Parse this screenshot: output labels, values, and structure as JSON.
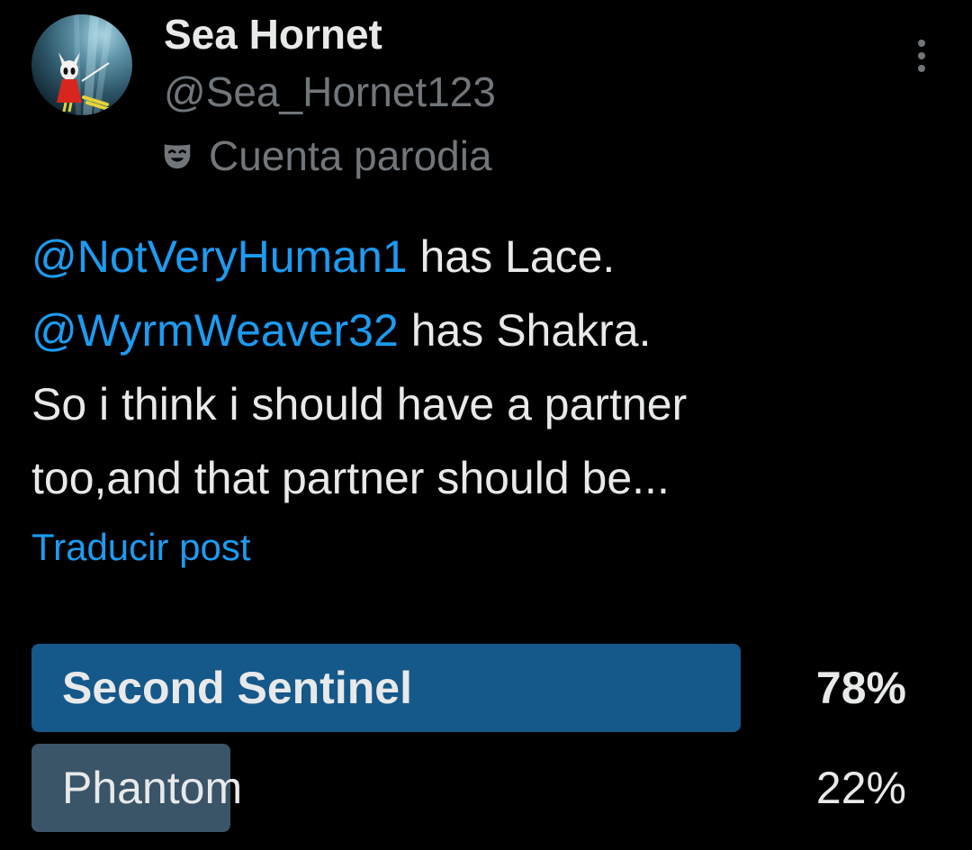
{
  "author": {
    "display_name": "Sea Hornet",
    "handle": "@Sea_Hornet123",
    "badge_label": "Cuenta parodia",
    "avatar_icon": "hornet-avatar",
    "badge_icon": "theater-mask-icon"
  },
  "menu_icon": "more-vertical-icon",
  "post": {
    "lines": [
      {
        "mention": "@NotVeryHuman1",
        "text": " has Lace."
      },
      {
        "mention": "@WyrmWeaver32",
        "text": " has Shakra."
      },
      {
        "text": "So i think i should have a partner"
      },
      {
        "text": "too,and that partner should be..."
      }
    ],
    "translate_label": "Traducir post"
  },
  "poll": {
    "options": [
      {
        "label": "Second Sentinel",
        "percent": "78%",
        "value": 78,
        "winner": true
      },
      {
        "label": "Phantom",
        "percent": "22%",
        "value": 22,
        "winner": false
      }
    ]
  },
  "colors": {
    "background": "#000000",
    "text": "#e7e9ea",
    "secondary_text": "#71767b",
    "link": "#1d9bf0",
    "poll_winner_bar": "#15588a",
    "poll_other_bar": "#3a5468"
  }
}
